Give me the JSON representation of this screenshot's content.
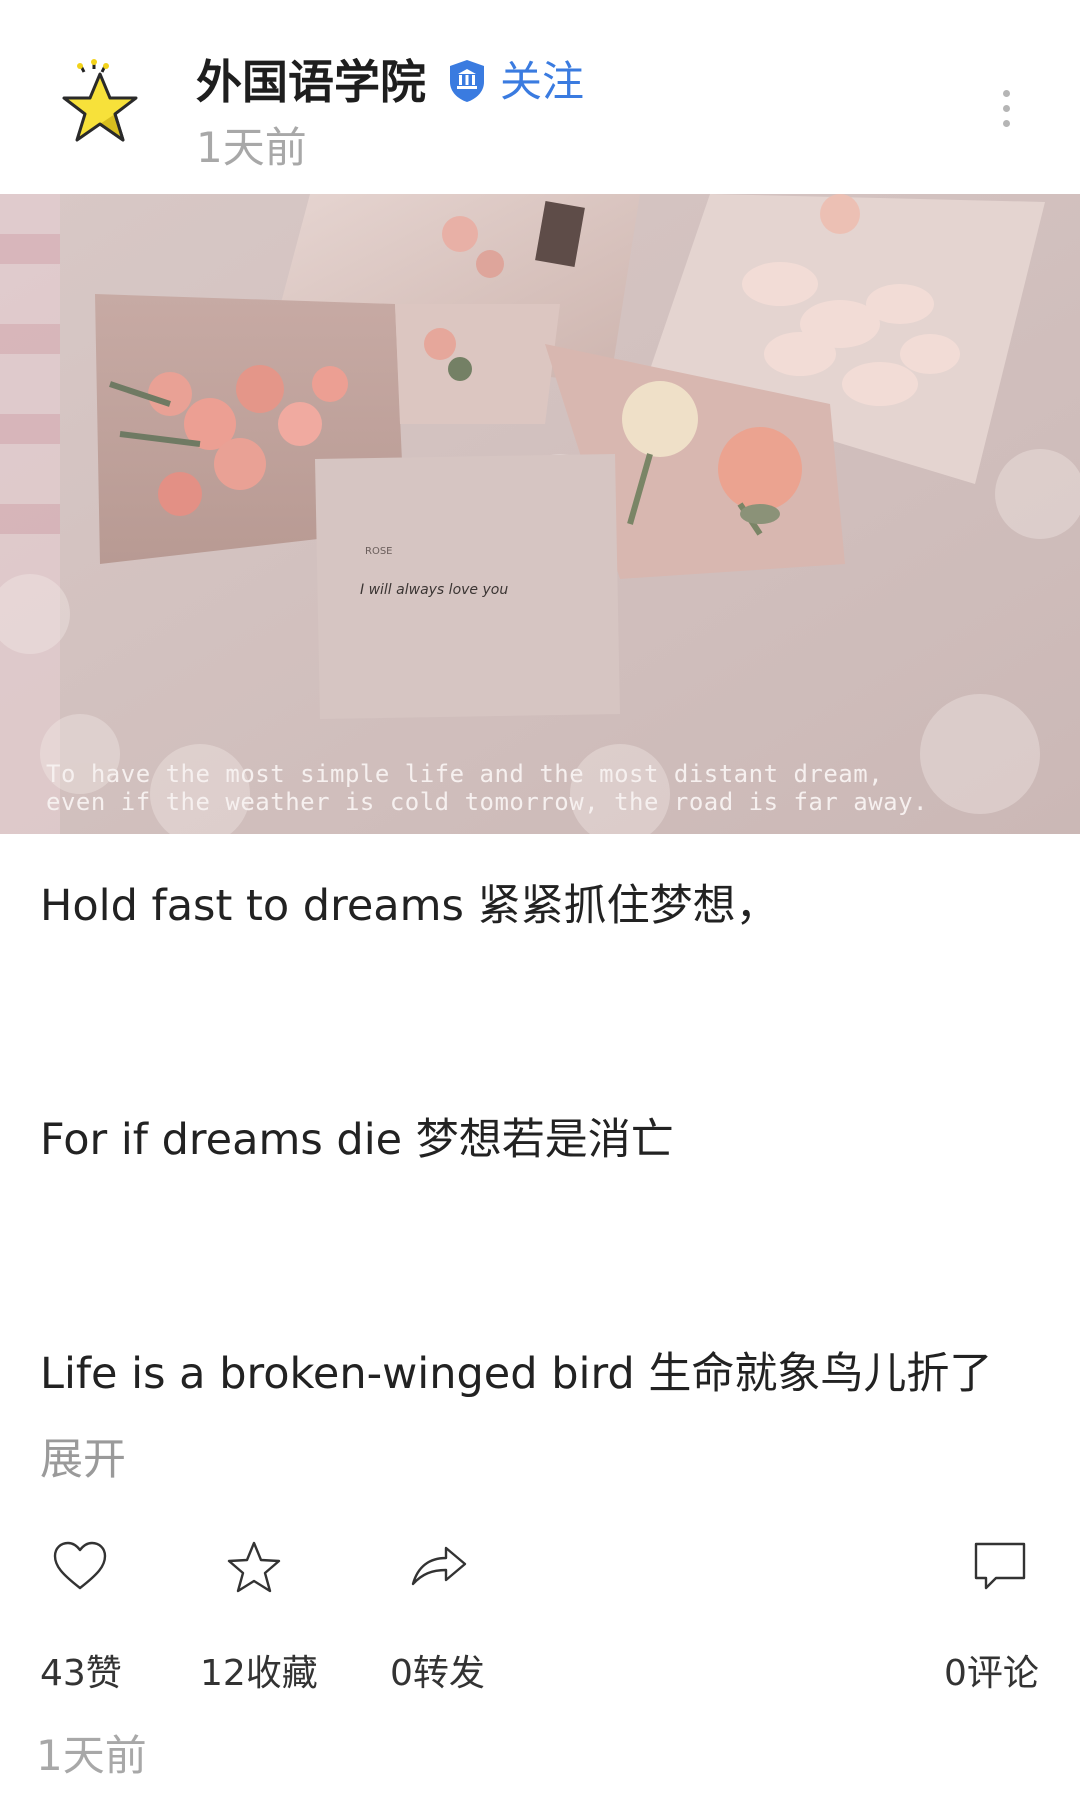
{
  "header": {
    "author_name": "外国语学院",
    "follow_label": "关注",
    "time": "1天前",
    "avatar_icon": "star-icon",
    "verified_icon": "verified-institution-icon",
    "more_icon": "more-vertical-icon"
  },
  "image": {
    "caption_line1": "To have the most simple life and the most distant dream,",
    "caption_line2": "even if the weather is cold tomorrow, the road is far away.",
    "card_note": "I will always love you"
  },
  "body": {
    "lines": [
      "Hold fast to dreams 紧紧抓住梦想，",
      "For if dreams die 梦想若是消亡",
      "Life is a broken-winged bird 生命就象鸟儿折了"
    ],
    "expand_label": "展开"
  },
  "actions": {
    "like_label": "43赞",
    "favorite_label": "12收藏",
    "share_label": "0转发",
    "comment_label": "0评论"
  },
  "footer": {
    "time": "1天前"
  },
  "colors": {
    "accent": "#3a7be0",
    "muted": "#a8a8a8",
    "text": "#222222"
  }
}
